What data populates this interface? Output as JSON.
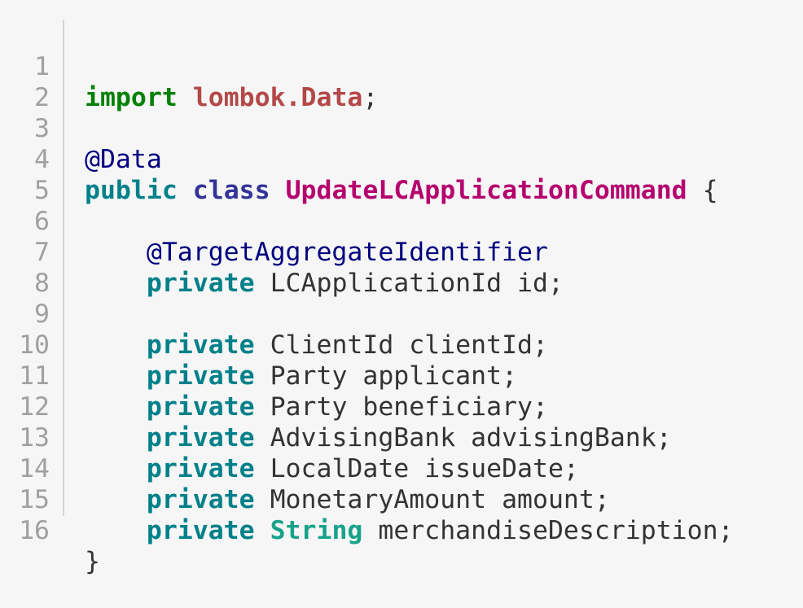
{
  "code": {
    "line_numbers": [
      "1",
      "2",
      "3",
      "4",
      "5",
      "6",
      "7",
      "8",
      "9",
      "10",
      "11",
      "12",
      "13",
      "14",
      "15",
      "16"
    ],
    "l1": {
      "kw": "import",
      "pkg": "lombok.Data",
      "semi": ";"
    },
    "l3": {
      "ann": "@Data"
    },
    "l4": {
      "public": "public",
      "class": "class",
      "name": "UpdateLCApplicationCommand",
      "brace": "{"
    },
    "l6": {
      "ann": "@TargetAggregateIdentifier"
    },
    "l7": {
      "kw": "private",
      "rest": "LCApplicationId id;"
    },
    "l9": {
      "kw": "private",
      "rest": "ClientId clientId;"
    },
    "l10": {
      "kw": "private",
      "rest": "Party applicant;"
    },
    "l11": {
      "kw": "private",
      "rest": "Party beneficiary;"
    },
    "l12": {
      "kw": "private",
      "rest": "AdvisingBank advisingBank;"
    },
    "l13": {
      "kw": "private",
      "rest": "LocalDate issueDate;"
    },
    "l14": {
      "kw": "private",
      "rest": "MonetaryAmount amount;"
    },
    "l15": {
      "kw": "private",
      "type": "String",
      "rest": "merchandiseDescription;"
    },
    "l16": {
      "brace": "}"
    }
  },
  "colors": {
    "background": "#f6f6f6",
    "line_number": "#a0a0a0",
    "keyword_import": "#008000",
    "keyword_private": "#00808a",
    "keyword_class": "#333399",
    "package_name": "#b44848",
    "annotation": "#000080",
    "class_name": "#b5006e",
    "builtin_type": "#18a28a",
    "text": "#333333"
  }
}
